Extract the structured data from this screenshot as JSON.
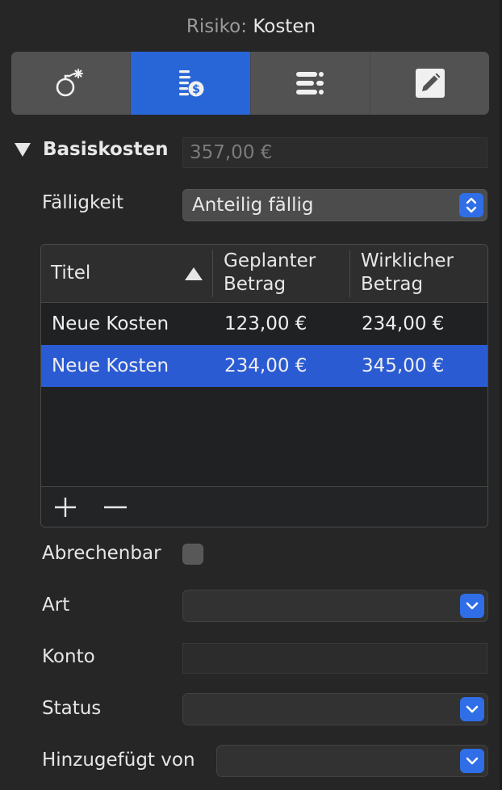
{
  "header": {
    "title_prefix": "Risiko:",
    "title_main": "Kosten"
  },
  "tabs": [
    {
      "icon": "bomb-icon",
      "active": false
    },
    {
      "icon": "cost-list-icon",
      "active": true
    },
    {
      "icon": "list-icon",
      "active": false
    },
    {
      "icon": "edit-icon",
      "active": false
    }
  ],
  "basiskosten": {
    "label": "Basiskosten",
    "value": "357,00 €"
  },
  "faelligkeit": {
    "label": "Fälligkeit",
    "value": "Anteilig fällig"
  },
  "costs_table": {
    "columns": [
      {
        "line1": "Titel",
        "line2": ""
      },
      {
        "line1": "Geplanter",
        "line2": "Betrag"
      },
      {
        "line1": "Wirklicher",
        "line2": "Betrag"
      }
    ],
    "rows": [
      {
        "title": "Neue Kosten",
        "planned": "123,00 €",
        "actual": "234,00 €",
        "selected": false
      },
      {
        "title": "Neue Kosten",
        "planned": "234,00 €",
        "actual": "345,00 €",
        "selected": true
      }
    ]
  },
  "fields": {
    "abrechenbar_label": "Abrechenbar",
    "abrechenbar_checked": false,
    "art_label": "Art",
    "art_value": "",
    "konto_label": "Konto",
    "konto_value": "",
    "status_label": "Status",
    "status_value": "",
    "hinzugefuegt_label": "Hinzugefügt von",
    "hinzugefuegt_value": ""
  },
  "colors": {
    "accent": "#2866d8",
    "background": "#262626"
  }
}
